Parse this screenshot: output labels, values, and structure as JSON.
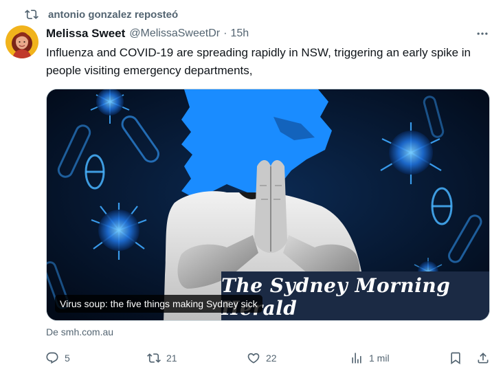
{
  "repost": {
    "text": "antonio gonzalez reposteó",
    "icon": "retweet-icon"
  },
  "author": {
    "name": "Melissa Sweet",
    "handle": "@MelissaSweetDr",
    "separator": "·",
    "time": "15h"
  },
  "tweet": {
    "text": "Influenza and COVID-19 are spreading rapidly in NSW, triggering an early spike in people visiting emergency departments,"
  },
  "card": {
    "caption": "Virus soup: the five things making Sydney sick",
    "masthead": "The Sydney Morning Herald",
    "source": "De smh.com.au"
  },
  "actions": {
    "reply": {
      "count": "5",
      "icon": "reply-icon"
    },
    "retweet": {
      "count": "21",
      "icon": "retweet-icon"
    },
    "like": {
      "count": "22",
      "icon": "heart-icon"
    },
    "views": {
      "count": "1 mil",
      "icon": "analytics-icon"
    },
    "bookmark": {
      "icon": "bookmark-icon"
    },
    "share": {
      "icon": "share-icon"
    }
  },
  "colors": {
    "text": "#0f1419",
    "secondary": "#536471",
    "virus_blue": "#1e90ff"
  }
}
